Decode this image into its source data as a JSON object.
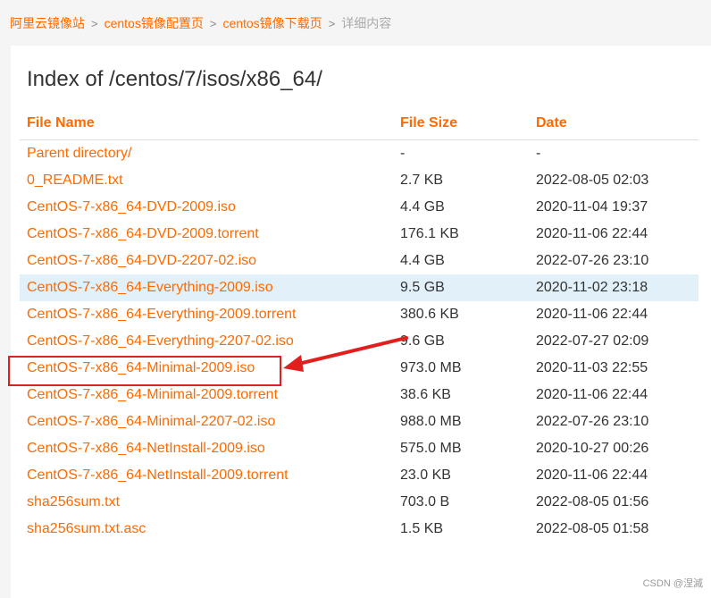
{
  "breadcrumb": {
    "items": [
      "阿里云镜像站",
      "centos镜像配置页",
      "centos镜像下载页"
    ],
    "current": "详细内容",
    "separator": ">"
  },
  "page": {
    "title": "Index of /centos/7/isos/x86_64/"
  },
  "table": {
    "headers": [
      "File Name",
      "File Size",
      "Date"
    ],
    "rows": [
      {
        "name": "Parent directory/",
        "size": "-",
        "date": "-"
      },
      {
        "name": "0_README.txt",
        "size": "2.7 KB",
        "date": "2022-08-05 02:03"
      },
      {
        "name": "CentOS-7-x86_64-DVD-2009.iso",
        "size": "4.4 GB",
        "date": "2020-11-04 19:37"
      },
      {
        "name": "CentOS-7-x86_64-DVD-2009.torrent",
        "size": "176.1 KB",
        "date": "2020-11-06 22:44"
      },
      {
        "name": "CentOS-7-x86_64-DVD-2207-02.iso",
        "size": "4.4 GB",
        "date": "2022-07-26 23:10"
      },
      {
        "name": "CentOS-7-x86_64-Everything-2009.iso",
        "size": "9.5 GB",
        "date": "2020-11-02 23:18"
      },
      {
        "name": "CentOS-7-x86_64-Everything-2009.torrent",
        "size": "380.6 KB",
        "date": "2020-11-06 22:44"
      },
      {
        "name": "CentOS-7-x86_64-Everything-2207-02.iso",
        "size": "9.6 GB",
        "date": "2022-07-27 02:09"
      },
      {
        "name": "CentOS-7-x86_64-Minimal-2009.iso",
        "size": "973.0 MB",
        "date": "2020-11-03 22:55"
      },
      {
        "name": "CentOS-7-x86_64-Minimal-2009.torrent",
        "size": "38.6 KB",
        "date": "2020-11-06 22:44"
      },
      {
        "name": "CentOS-7-x86_64-Minimal-2207-02.iso",
        "size": "988.0 MB",
        "date": "2022-07-26 23:10"
      },
      {
        "name": "CentOS-7-x86_64-NetInstall-2009.iso",
        "size": "575.0 MB",
        "date": "2020-10-27 00:26"
      },
      {
        "name": "CentOS-7-x86_64-NetInstall-2009.torrent",
        "size": "23.0 KB",
        "date": "2020-11-06 22:44"
      },
      {
        "name": "sha256sum.txt",
        "size": "703.0 B",
        "date": "2022-08-05 01:56"
      },
      {
        "name": "sha256sum.txt.asc",
        "size": "1.5 KB",
        "date": "2022-08-05 01:58"
      }
    ]
  },
  "watermark": "CSDN @涅滅",
  "colors": {
    "link": "#ff6a00",
    "highlight_row": "#e2f1f9",
    "annotation": "#e0201f"
  }
}
